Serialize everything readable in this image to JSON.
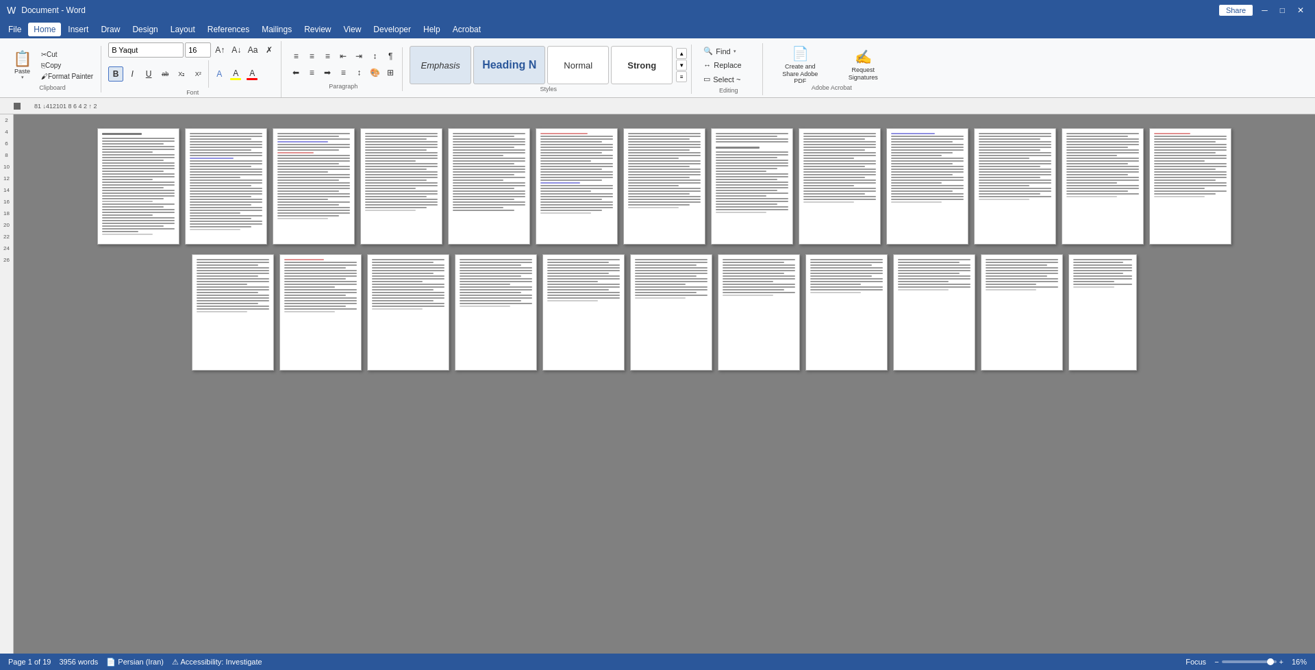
{
  "titlebar": {
    "doc_name": "Document - Word",
    "share_label": "Share"
  },
  "menubar": {
    "items": [
      "File",
      "Home",
      "Insert",
      "Draw",
      "Design",
      "Layout",
      "References",
      "Mailings",
      "Review",
      "View",
      "Developer",
      "Help",
      "Acrobat"
    ]
  },
  "ribbon": {
    "clipboard": {
      "paste_label": "Paste",
      "cut_label": "Cut",
      "copy_label": "Copy",
      "format_painter_label": "Format Painter"
    },
    "font": {
      "font_name": "B Yaqut",
      "font_size": "16",
      "bold_label": "B",
      "italic_label": "I",
      "underline_label": "U",
      "strikethrough_label": "ab",
      "subscript_label": "X₂",
      "superscript_label": "X²",
      "font_color_label": "A",
      "highlight_label": "A",
      "text_color_label": "A"
    },
    "paragraph": {
      "bullets_label": "≡",
      "numbering_label": "≡",
      "multilevel_label": "≡",
      "decrease_indent_label": "←",
      "increase_indent_label": "→",
      "sort_label": "↕",
      "show_marks_label": "¶"
    },
    "styles": {
      "emphasis_label": "Emphasis",
      "heading_label": "Heading N",
      "normal_label": "Normal",
      "strong_label": "Strong"
    },
    "editing": {
      "find_label": "Find",
      "replace_label": "Replace",
      "select_label": "Select ~"
    },
    "adobe": {
      "create_share_label": "Create and Share Adobe PDF",
      "request_signatures_label": "Request Signatures"
    },
    "section_labels": {
      "clipboard": "Clipboard",
      "font": "Font",
      "paragraph": "Paragraph",
      "styles": "Styles",
      "editing": "Editing",
      "adobe_acrobat": "Adobe Acrobat"
    }
  },
  "ruler": {
    "numbers": "81  ↓412101 8 6 4 2  ↑ 2"
  },
  "status": {
    "page_info": "Page 1 of 19",
    "words": "3956 words",
    "language": "Persian (Iran)",
    "accessibility": "Accessibility: Investigate",
    "focus": "Focus",
    "zoom": "16%"
  },
  "vertical_ruler": {
    "numbers": [
      "2",
      "4",
      "6",
      "8",
      "10",
      "12",
      "14",
      "16",
      "18",
      "20",
      "22",
      "24",
      "26"
    ]
  }
}
